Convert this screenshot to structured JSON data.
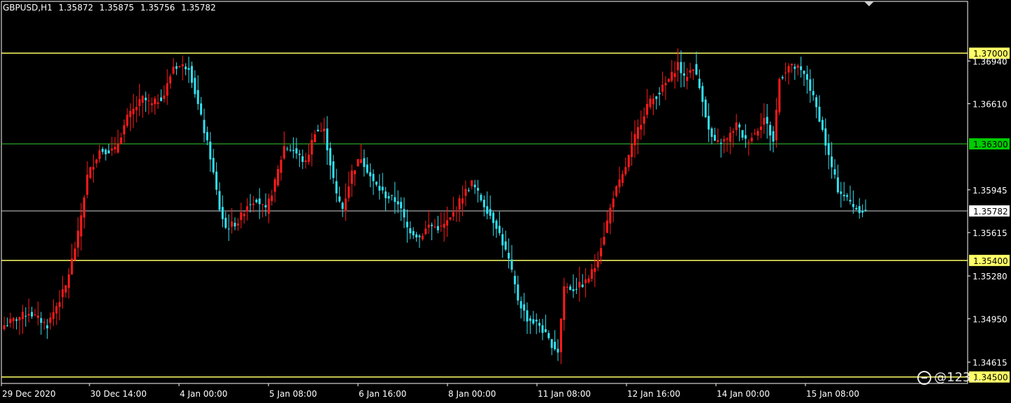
{
  "header": {
    "symbol": "GBPUSD,H1",
    "open": "1.35872",
    "high": "1.35875",
    "low": "1.35756",
    "close": "1.35782"
  },
  "watermark": "@123...",
  "colors": {
    "background": "#000000",
    "bull": "#ff1a1a",
    "bear": "#33e0f0",
    "axis": "#ffffff",
    "level_yellow": "#ffff66",
    "level_green": "#33cc33",
    "level_price": "#cfcfcf"
  },
  "chart_data": {
    "type": "candlestick",
    "symbol": "GBPUSD",
    "timeframe": "H1",
    "ylim": [
      1.3445,
      1.374
    ],
    "y_ticks": [
      "1.36940",
      "1.36610",
      "1.35945",
      "1.35615",
      "1.35280",
      "1.34950",
      "1.34615"
    ],
    "x_ticks": [
      "29 Dec 2020",
      "30 Dec 14:00",
      "4 Jan 00:00",
      "5 Jan 08:00",
      "6 Jan 16:00",
      "8 Jan 00:00",
      "11 Jan 08:00",
      "12 Jan 16:00",
      "14 Jan 00:00",
      "15 Jan 08:00"
    ],
    "levels": [
      {
        "value": 1.37,
        "label": "1.37000",
        "color": "yellow"
      },
      {
        "value": 1.363,
        "label": "1.36300",
        "color": "green"
      },
      {
        "value": 1.35782,
        "label": "1.35782",
        "color": "price"
      },
      {
        "value": 1.354,
        "label": "1.35400",
        "color": "yellow"
      },
      {
        "value": 1.345,
        "label": "1.34500",
        "color": "yellow"
      }
    ],
    "close_path": [
      [
        0,
        1.349
      ],
      [
        8,
        1.35
      ],
      [
        14,
        1.349
      ],
      [
        20,
        1.352
      ],
      [
        24,
        1.356
      ],
      [
        27,
        1.3605
      ],
      [
        31,
        1.3625
      ],
      [
        36,
        1.3625
      ],
      [
        40,
        1.365
      ],
      [
        45,
        1.3665
      ],
      [
        48,
        1.366
      ],
      [
        52,
        1.3668
      ],
      [
        55,
        1.369
      ],
      [
        60,
        1.369
      ],
      [
        63,
        1.366
      ],
      [
        67,
        1.362
      ],
      [
        70,
        1.358
      ],
      [
        72,
        1.3565
      ],
      [
        76,
        1.357
      ],
      [
        79,
        1.3583
      ],
      [
        82,
        1.3588
      ],
      [
        85,
        1.3578
      ],
      [
        88,
        1.36
      ],
      [
        91,
        1.3628
      ],
      [
        94,
        1.3625
      ],
      [
        98,
        1.3615
      ],
      [
        101,
        1.364
      ],
      [
        104,
        1.364
      ],
      [
        108,
        1.359
      ],
      [
        110,
        1.358
      ],
      [
        113,
        1.3608
      ],
      [
        116,
        1.362
      ],
      [
        120,
        1.36
      ],
      [
        124,
        1.359
      ],
      [
        128,
        1.3585
      ],
      [
        131,
        1.3565
      ],
      [
        135,
        1.3558
      ],
      [
        138,
        1.3567
      ],
      [
        142,
        1.3565
      ],
      [
        145,
        1.3572
      ],
      [
        149,
        1.359
      ],
      [
        152,
        1.36
      ],
      [
        156,
        1.3583
      ],
      [
        160,
        1.3567
      ],
      [
        164,
        1.354
      ],
      [
        167,
        1.351
      ],
      [
        170,
        1.3495
      ],
      [
        174,
        1.349
      ],
      [
        177,
        1.3478
      ],
      [
        180,
        1.347
      ],
      [
        182,
        1.352
      ],
      [
        185,
        1.3518
      ],
      [
        189,
        1.3523
      ],
      [
        192,
        1.3535
      ],
      [
        195,
        1.356
      ],
      [
        198,
        1.359
      ],
      [
        201,
        1.3605
      ],
      [
        205,
        1.3635
      ],
      [
        209,
        1.366
      ],
      [
        213,
        1.367
      ],
      [
        217,
        1.3683
      ],
      [
        219,
        1.3692
      ],
      [
        221,
        1.368
      ],
      [
        224,
        1.369
      ],
      [
        227,
        1.3665
      ],
      [
        229,
        1.364
      ],
      [
        231,
        1.363
      ],
      [
        235,
        1.3633
      ],
      [
        238,
        1.3645
      ],
      [
        241,
        1.3632
      ],
      [
        244,
        1.3638
      ],
      [
        247,
        1.365
      ],
      [
        250,
        1.3632
      ],
      [
        252,
        1.368
      ],
      [
        255,
        1.369
      ],
      [
        258,
        1.3688
      ],
      [
        261,
        1.368
      ],
      [
        265,
        1.365
      ],
      [
        268,
        1.362
      ],
      [
        271,
        1.3595
      ],
      [
        275,
        1.3585
      ],
      [
        277,
        1.358
      ],
      [
        280,
        1.3578
      ]
    ]
  }
}
